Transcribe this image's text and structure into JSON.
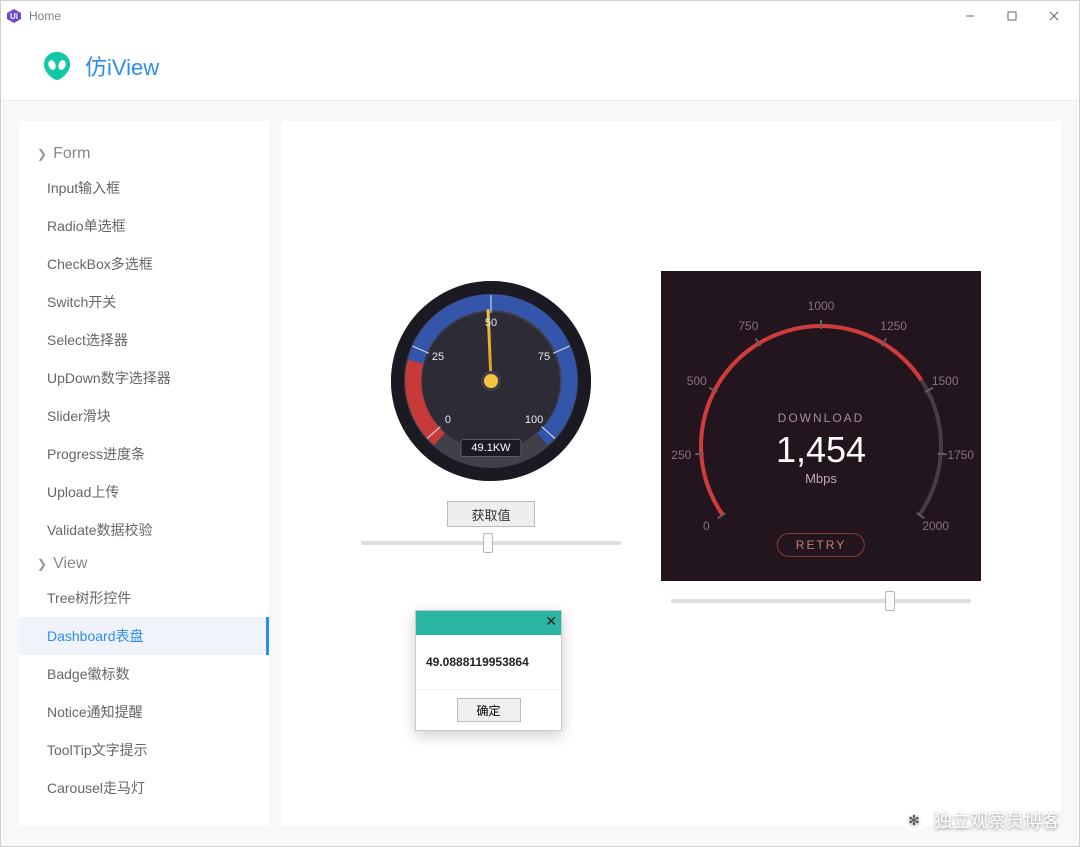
{
  "window": {
    "title": "Home"
  },
  "brand": "仿iView",
  "sidebar": {
    "sections": [
      {
        "label": "Form",
        "items": [
          {
            "label": "Input输入框"
          },
          {
            "label": "Radio单选框"
          },
          {
            "label": "CheckBox多选框"
          },
          {
            "label": "Switch开关"
          },
          {
            "label": "Select选择器"
          },
          {
            "label": "UpDown数字选择器"
          },
          {
            "label": "Slider滑块"
          },
          {
            "label": "Progress进度条"
          },
          {
            "label": "Upload上传"
          },
          {
            "label": "Validate数据校验"
          }
        ]
      },
      {
        "label": "View",
        "items": [
          {
            "label": "Tree树形控件"
          },
          {
            "label": "Dashboard表盘",
            "active": true
          },
          {
            "label": "Badge徽标数"
          },
          {
            "label": "Notice通知提醒"
          },
          {
            "label": "ToolTip文字提示"
          },
          {
            "label": "Carousel走马灯"
          }
        ]
      }
    ]
  },
  "gauge1": {
    "ticks": [
      "0",
      "25",
      "50",
      "75",
      "100"
    ],
    "value_display": "49.1KW",
    "action_button": "获取值",
    "slider_pos_pct": 49
  },
  "gauge2": {
    "ticks": [
      "0",
      "250",
      "500",
      "750",
      "1000",
      "1250",
      "1500",
      "1750",
      "2000"
    ],
    "download_label": "DOWNLOAD",
    "value": "1,454",
    "unit": "Mbps",
    "retry_label": "RETRY",
    "slider_pos_pct": 73
  },
  "dialog": {
    "message": "49.0888119953864",
    "ok_label": "确定"
  },
  "watermark": "独立观察员博客",
  "colors": {
    "accent": "#2d8cf0",
    "alien": "#10c9a8",
    "gauge_red": "#c83a3a",
    "gauge_blue": "#3355aa"
  },
  "chart_data": [
    {
      "type": "gauge",
      "title": "Power",
      "min": 0,
      "max": 100,
      "ticks": [
        0,
        25,
        50,
        75,
        100
      ],
      "value": 49.0888119953864,
      "display": "49.1KW",
      "unit": "KW",
      "arc_segments": [
        {
          "from": 0,
          "to": 30,
          "color": "#c83a3a"
        },
        {
          "from": 30,
          "to": 100,
          "color": "#3355aa"
        }
      ]
    },
    {
      "type": "gauge",
      "title": "DOWNLOAD",
      "min": 0,
      "max": 2000,
      "ticks": [
        0,
        250,
        500,
        750,
        1000,
        1250,
        1500,
        1750,
        2000
      ],
      "value": 1454,
      "unit": "Mbps",
      "arc_segments": [
        {
          "from": 0,
          "to": 1454,
          "color": "#d23b3b"
        },
        {
          "from": 1454,
          "to": 2000,
          "color": "#4a3c44"
        }
      ]
    }
  ]
}
